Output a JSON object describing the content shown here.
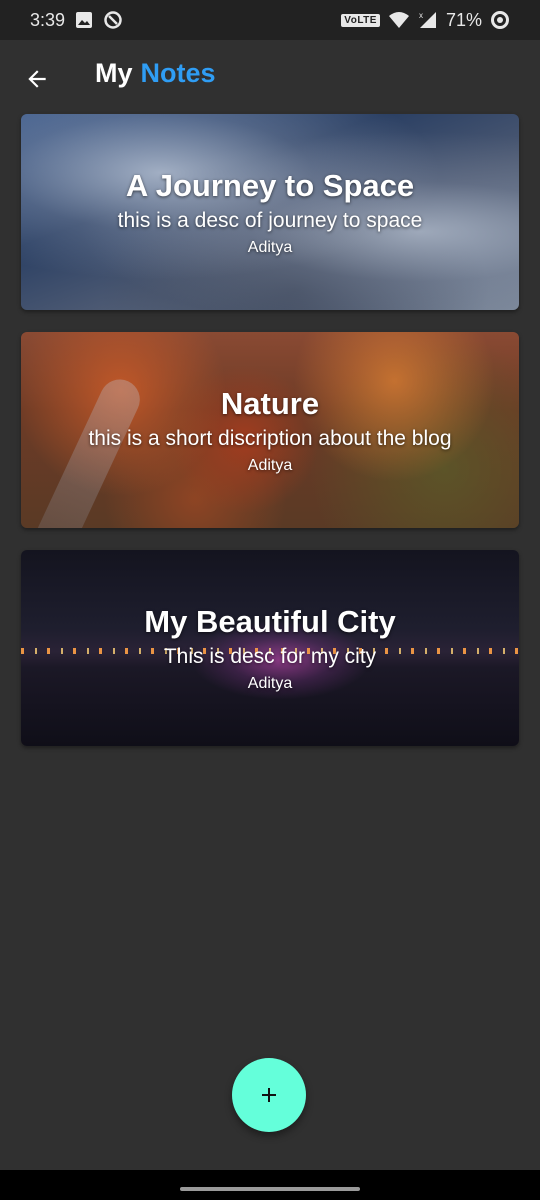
{
  "status_bar": {
    "time": "3:39",
    "volte": "VoLTE",
    "battery": "71%",
    "icons": [
      "image-icon",
      "sync-icon",
      "wifi-icon",
      "signal-icon",
      "battery-saver-icon"
    ]
  },
  "app_bar": {
    "title_part1": "My",
    "title_part2": "Notes",
    "back_icon": "arrow-back-icon"
  },
  "notes": [
    {
      "title": "A Journey to Space",
      "description": "this is a desc of journey to space",
      "author": "Aditya"
    },
    {
      "title": "Nature",
      "description": "this is a short discription about the blog",
      "author": "Aditya"
    },
    {
      "title": "My Beautiful City",
      "description": "This is desc for my city",
      "author": "Aditya"
    }
  ],
  "fab": {
    "icon": "plus-icon"
  },
  "colors": {
    "background": "#303030",
    "status_bar": "#222222",
    "accent_title": "#2f9df4",
    "fab": "#64ffda"
  }
}
